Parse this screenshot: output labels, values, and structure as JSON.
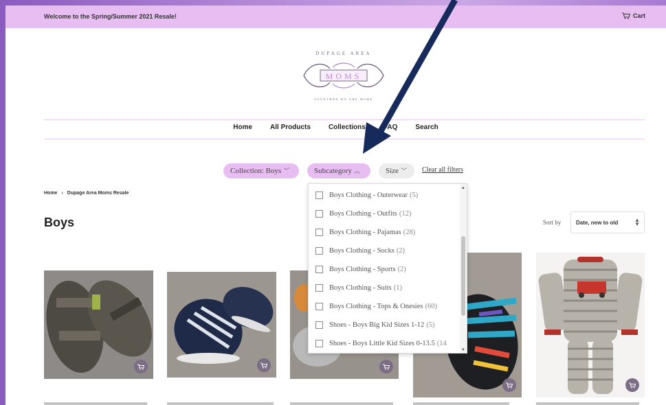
{
  "announcement": {
    "message": "Welcome to the Spring/Summer 2021 Resale!",
    "cart_label": "Cart"
  },
  "logo": {
    "top_text": "DUPAGE AREA",
    "main_text": "MOMS",
    "bottom_text": "TOGETHER WE ARE MORE"
  },
  "nav": {
    "items": [
      "Home",
      "All Products",
      "Collections",
      "FAQ",
      "Search"
    ]
  },
  "filters": {
    "collection": "Collection: Boys",
    "subcategory": "Subcategory",
    "size": "Size",
    "clear_all": "Clear all filters"
  },
  "breadcrumb": {
    "home": "Home",
    "sep": "›",
    "current": "Dupage Area Moms Resale"
  },
  "page_title": "Boys",
  "sort": {
    "label": "Sort by",
    "value": "Date, new to old"
  },
  "dropdown": {
    "items": [
      {
        "label": "Boys Clothing - Outerwear",
        "count": "(5)"
      },
      {
        "label": "Boys Clothing - Outfits",
        "count": "(12)"
      },
      {
        "label": "Boys Clothing - Pajamas",
        "count": "(28)"
      },
      {
        "label": "Boys Clothing - Socks",
        "count": "(2)"
      },
      {
        "label": "Boys Clothing - Sports",
        "count": "(2)"
      },
      {
        "label": "Boys Clothing - Suits",
        "count": "(1)"
      },
      {
        "label": "Boys Clothing - Tops & Onesies",
        "count": "(60)"
      },
      {
        "label": "Shoes - Boys Big Kid Sizes 1-12",
        "count": "(5)"
      },
      {
        "label": "Shoes - Boys Little Kid Sizes 0-13.5",
        "count": "(14"
      }
    ]
  },
  "colors": {
    "announcement_bg": "#e7bdf2",
    "active_pill": "#e7bdf2",
    "arrow": "#172a5c",
    "quick_add": "#7b6d86"
  },
  "icons": {
    "cart": "cart-icon",
    "quick_add": "cart-plus-icon",
    "chevron": "chevron-icon"
  }
}
